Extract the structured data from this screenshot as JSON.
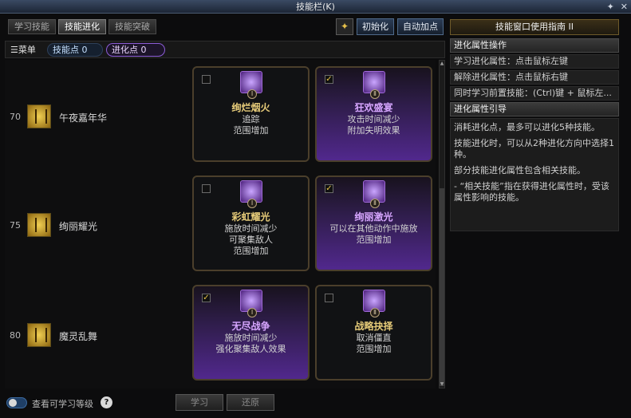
{
  "window": {
    "title": "技能栏(K)"
  },
  "tabs": [
    {
      "label": "学习技能",
      "active": false
    },
    {
      "label": "技能进化",
      "active": true
    },
    {
      "label": "技能突破",
      "active": false
    }
  ],
  "toolbar": {
    "reset_label": "初始化",
    "auto_label": "自动加点"
  },
  "menubar": {
    "menu_label": "☰菜单",
    "skill_points": "技能点 0",
    "evolution_points": "进化点 0"
  },
  "skills": [
    {
      "level": "70",
      "name": "午夜嘉年华",
      "options": [
        {
          "roman": "Ⅰ",
          "title": "绚烂烟火",
          "desc": [
            "追踪",
            "范围增加"
          ],
          "checked": false
        },
        {
          "roman": "Ⅱ",
          "title": "狂欢盛宴",
          "desc": [
            "攻击时间减少",
            "附加失明效果"
          ],
          "checked": true
        }
      ]
    },
    {
      "level": "75",
      "name": "绚丽耀光",
      "options": [
        {
          "roman": "Ⅰ",
          "title": "彩虹耀光",
          "desc": [
            "施放时间减少",
            "可聚集敌人",
            "范围增加"
          ],
          "checked": false
        },
        {
          "roman": "Ⅱ",
          "title": "绚丽激光",
          "desc": [
            "可以在其他动作中施放",
            "范围增加"
          ],
          "checked": true
        }
      ]
    },
    {
      "level": "80",
      "name": "魔灵乱舞",
      "options": [
        {
          "roman": "Ⅰ",
          "title": "无尽战争",
          "desc": [
            "施放时间减少",
            "强化聚集敌人效果"
          ],
          "checked": true
        },
        {
          "roman": "Ⅱ",
          "title": "战略抉择",
          "desc": [
            "取消僵直",
            "范围增加"
          ],
          "checked": false
        }
      ]
    }
  ],
  "bottom": {
    "toggle_label": "查看可学习等级",
    "help": "?",
    "learn_label": "学习",
    "restore_label": "还原"
  },
  "guide": {
    "title": "技能窗口使用指南 II",
    "section1": "进化属性操作",
    "lines": [
      "学习进化属性：点击鼠标左键",
      "解除进化属性：点击鼠标右键",
      "同时学习前置技能：(Ctrl)键 + 鼠标左..."
    ],
    "section2": "进化属性引导",
    "paragraphs": [
      "消耗进化点，最多可以进化5种技能。",
      "技能进化时，可以从2种进化方向中选择1种。",
      "部分技能进化属性包含相关技能。",
      "- “相关技能”指在获得进化属性时，受该属性影响的技能。"
    ]
  }
}
